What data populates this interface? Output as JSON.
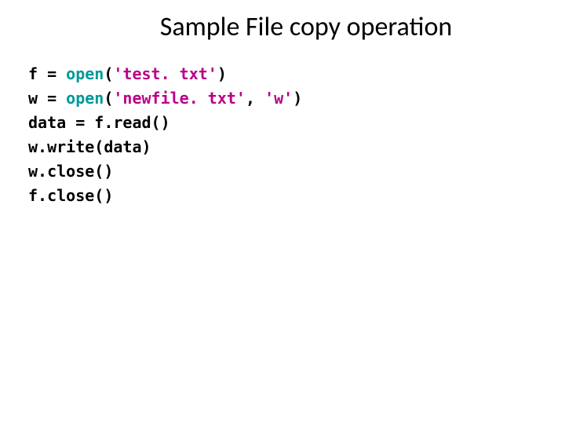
{
  "slide": {
    "title": "Sample File copy operation",
    "code": {
      "line1": {
        "a": "f = ",
        "func": "open",
        "lparen": "(",
        "str": "'test. txt'",
        "rparen": ")"
      },
      "line2": {
        "a": "w = ",
        "func": "open",
        "lparen": "(",
        "str1": "'newfile. txt'",
        "comma": ", ",
        "str2": "'w'",
        "rparen": ")"
      },
      "line3": {
        "a": "data = f.read()"
      },
      "line4": {
        "a": "w.write(data)"
      },
      "line5": {
        "a": "w.close()"
      },
      "line6": {
        "a": "f.close()"
      }
    }
  }
}
